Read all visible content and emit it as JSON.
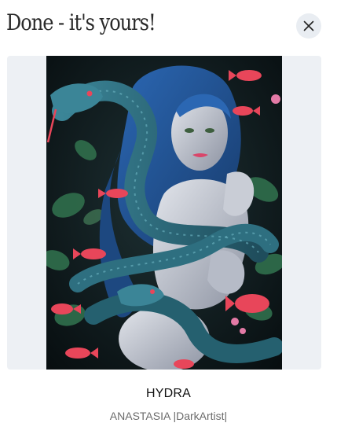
{
  "dialog": {
    "title": "Done - it's yours!",
    "close_icon": "close-icon"
  },
  "artwork": {
    "name": "HYDRA",
    "artist": "ANASTASIA |DarkArtist|",
    "colors": {
      "frame_bg": "#edf0f4",
      "background": "#0e1a1c",
      "hair": "#1f4f8f",
      "snake": "#2e6f80",
      "skin": "#c9cdd6",
      "fish": "#e8465a",
      "leaves": "#2f6b4a"
    }
  }
}
